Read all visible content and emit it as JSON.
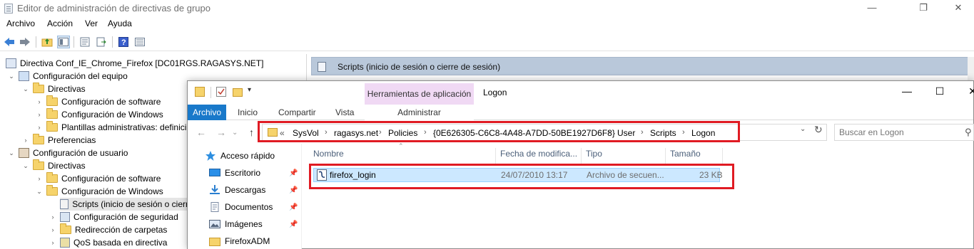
{
  "gpo": {
    "title": "Editor de administración de directivas de grupo",
    "menu": [
      "Archivo",
      "Acción",
      "Ver",
      "Ayuda"
    ],
    "tree": [
      {
        "label": "Directiva Conf_IE_Chrome_Firefox [DC01RGS.RAGASYS.NET]"
      },
      {
        "label": "Configuración del equipo"
      },
      {
        "label": "Directivas"
      },
      {
        "label": "Configuración de software"
      },
      {
        "label": "Configuración de Windows"
      },
      {
        "label": "Plantillas administrativas: definici"
      },
      {
        "label": "Preferencias"
      },
      {
        "label": "Configuración de usuario"
      },
      {
        "label": "Directivas"
      },
      {
        "label": "Configuración de software"
      },
      {
        "label": "Configuración de Windows"
      },
      {
        "label": "Scripts (inicio de sesión o cierr"
      },
      {
        "label": "Configuración de seguridad"
      },
      {
        "label": "Redirección de carpetas"
      },
      {
        "label": "QoS basada en directiva"
      }
    ],
    "right_header": "Scripts (inicio de sesión o cierre de sesión)"
  },
  "explorer": {
    "ribbon_context": "Herramientas de aplicación",
    "ribbon_context_sub": "Administrar",
    "window_title": "Logon",
    "tabs": [
      "Archivo",
      "Inicio",
      "Compartir",
      "Vista"
    ],
    "breadcrumb": [
      "SysVol",
      "ragasys.net",
      "Policies",
      "{0E626305-C6C8-4A48-A7DD-50BE1927D6F8}",
      "User",
      "Scripts",
      "Logon"
    ],
    "breadcrumb_prefix": "«",
    "search_placeholder": "Buscar en Logon",
    "nav": [
      {
        "label": "Acceso rápido",
        "icon": "star-icon"
      },
      {
        "label": "Escritorio",
        "icon": "desktop-icon"
      },
      {
        "label": "Descargas",
        "icon": "download-icon"
      },
      {
        "label": "Documentos",
        "icon": "document-icon"
      },
      {
        "label": "Imágenes",
        "icon": "image-icon"
      },
      {
        "label": "FirefoxADM",
        "icon": "folder-icon"
      }
    ],
    "columns": [
      "Nombre",
      "Fecha de modifica...",
      "Tipo",
      "Tamaño"
    ],
    "files": [
      {
        "name": "firefox_login",
        "date": "24/07/2010 13:17",
        "type": "Archivo de secuen...",
        "size": "23 KB"
      }
    ]
  },
  "colors": {
    "highlight_red": "#e01b23",
    "selection_blue": "#cce8ff",
    "ribbon_blue": "#1979ca",
    "context_pink": "#f0d9f4"
  }
}
